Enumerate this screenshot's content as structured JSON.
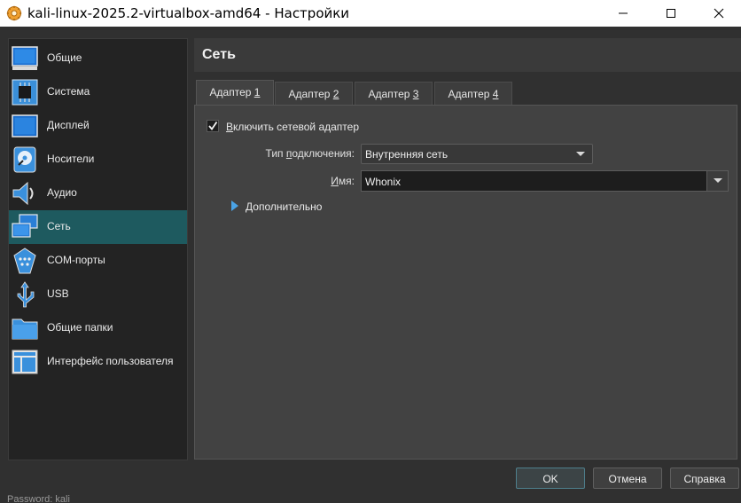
{
  "window": {
    "title": "kali-linux-2025.2-virtualbox-amd64 - Настройки",
    "icon": "virtualbox-gear-icon"
  },
  "sidebar": {
    "items": [
      {
        "label": "Общие",
        "icon": "general-icon"
      },
      {
        "label": "Система",
        "icon": "system-chip-icon"
      },
      {
        "label": "Дисплей",
        "icon": "display-icon"
      },
      {
        "label": "Носители",
        "icon": "storage-icon"
      },
      {
        "label": "Аудио",
        "icon": "audio-icon"
      },
      {
        "label": "Сеть",
        "icon": "network-icon",
        "selected": true
      },
      {
        "label": "COM-порты",
        "icon": "serial-ports-icon"
      },
      {
        "label": "USB",
        "icon": "usb-icon"
      },
      {
        "label": "Общие папки",
        "icon": "shared-folder-icon"
      },
      {
        "label": "Интерфейс пользователя",
        "icon": "user-interface-icon"
      }
    ]
  },
  "header": {
    "title": "Сеть"
  },
  "tabs": [
    {
      "label_pre": "Адаптер ",
      "label_key": "1",
      "active": true
    },
    {
      "label_pre": "Адаптер ",
      "label_key": "2"
    },
    {
      "label_pre": "Адаптер ",
      "label_key": "3"
    },
    {
      "label_pre": "Адаптер ",
      "label_key": "4"
    }
  ],
  "adapter": {
    "enable_checkbox": {
      "label_key": "В",
      "label_rest": "ключить сетевой адаптер",
      "checked": true
    },
    "attached_to": {
      "label_pre": "Тип ",
      "label_key": "п",
      "label_rest": "одключения:",
      "value": "Внутренняя сеть"
    },
    "name": {
      "label_key": "И",
      "label_rest": "мя:",
      "value": "Whonix"
    },
    "advanced": {
      "label_key": "Д",
      "label_rest": "ополнительно"
    }
  },
  "buttons": {
    "ok": "OK",
    "cancel": "Отмена",
    "help": "Справка"
  },
  "background_text": "Password: kali",
  "colors": {
    "selected_item": "#1e5a5f",
    "expander_arrow": "#4aa3e6",
    "panel_bg": "#424242"
  }
}
